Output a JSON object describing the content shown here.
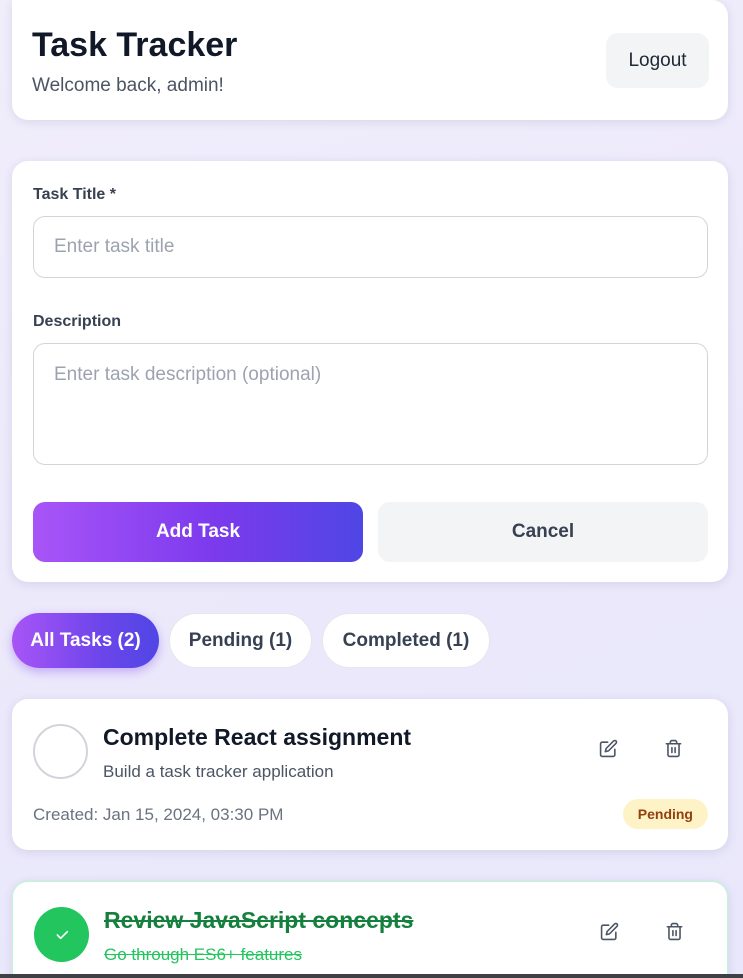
{
  "header": {
    "title": "Task Tracker",
    "welcome": "Welcome back, admin!",
    "logout_label": "Logout"
  },
  "form": {
    "title_label": "Task Title *",
    "title_placeholder": "Enter task title",
    "title_value": "",
    "description_label": "Description",
    "description_placeholder": "Enter task description (optional)",
    "description_value": "",
    "add_label": "Add Task",
    "cancel_label": "Cancel"
  },
  "filters": [
    {
      "label": "All Tasks (2)",
      "active": true
    },
    {
      "label": "Pending (1)",
      "active": false
    },
    {
      "label": "Completed (1)",
      "active": false
    }
  ],
  "tasks": [
    {
      "title": "Complete React assignment",
      "description": "Build a task tracker application",
      "created": "Created: Jan 15, 2024, 03:30 PM",
      "status": "Pending",
      "completed": false
    },
    {
      "title": "Review JavaScript concepts",
      "description": "Go through ES6+ features",
      "completed": true
    }
  ],
  "icons": {
    "edit": "edit-icon",
    "delete": "trash-icon",
    "check": "check-icon"
  },
  "colors": {
    "accent_start": "#a855f7",
    "accent_end": "#4f46e5",
    "completed_green": "#22c55e",
    "pending_badge_bg": "#fef3c7",
    "pending_badge_text": "#92400e"
  }
}
